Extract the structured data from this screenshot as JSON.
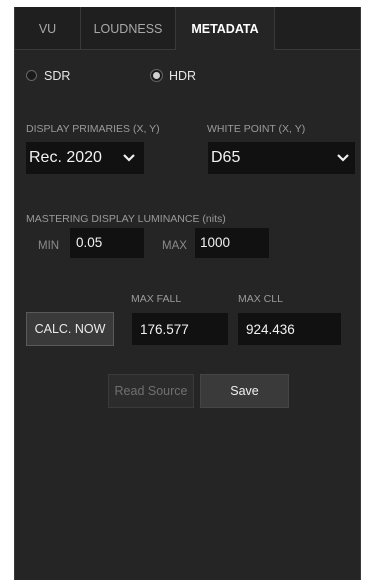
{
  "tabs": [
    {
      "label": "VU",
      "active": false
    },
    {
      "label": "LOUDNESS",
      "active": false
    },
    {
      "label": "METADATA",
      "active": true
    }
  ],
  "dynamic_range": {
    "options": [
      {
        "label": "SDR",
        "selected": false
      },
      {
        "label": "HDR",
        "selected": true
      }
    ]
  },
  "display_primaries": {
    "label": "DISPLAY PRIMARIES (X, Y)",
    "value": "Rec. 2020"
  },
  "white_point": {
    "label": "WHITE POINT (X, Y)",
    "value": "D65"
  },
  "mastering_luminance": {
    "label": "MASTERING DISPLAY LUMINANCE (nits)",
    "min_label": "MIN",
    "min_value": "0.05",
    "max_label": "MAX",
    "max_value": "1000"
  },
  "calc": {
    "button_label": "CALC. NOW",
    "max_fall_label": "MAX FALL",
    "max_fall_value": "176.577",
    "max_cll_label": "MAX CLL",
    "max_cll_value": "924.436"
  },
  "actions": {
    "read_source_label": "Read Source",
    "save_label": "Save"
  },
  "colors": {
    "panel_bg": "#252525",
    "field_bg": "#111111",
    "text": "#f2f2f2",
    "muted": "#9a9a9a"
  }
}
